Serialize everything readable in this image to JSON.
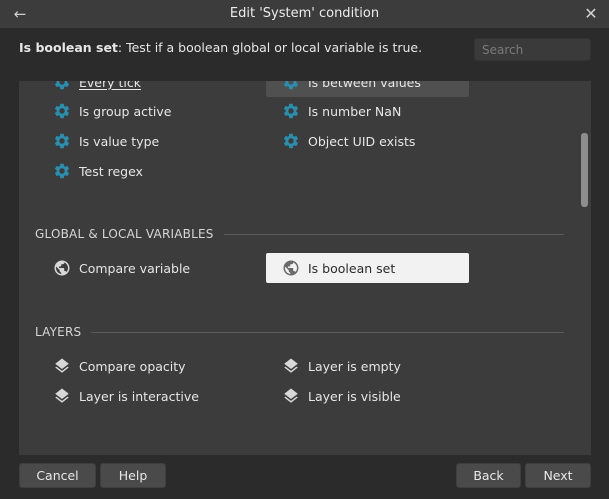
{
  "window": {
    "title": "Edit 'System' condition"
  },
  "description": {
    "name": "Is boolean set",
    "text": ": Test if a boolean global or local variable is true."
  },
  "search": {
    "placeholder": "Search"
  },
  "list": {
    "top_items": [
      {
        "label": "Every tick",
        "icon": "gear-icon"
      },
      {
        "label": "Is between values",
        "icon": "gear-icon"
      },
      {
        "label": "Is group active",
        "icon": "gear-icon"
      },
      {
        "label": "Is number NaN",
        "icon": "gear-icon"
      },
      {
        "label": "Is value type",
        "icon": "gear-icon"
      },
      {
        "label": "Object UID exists",
        "icon": "gear-icon"
      },
      {
        "label": "Test regex",
        "icon": "gear-icon"
      }
    ],
    "sections": [
      {
        "title": "GLOBAL & LOCAL VARIABLES",
        "items": [
          {
            "label": "Compare variable",
            "icon": "globe-icon"
          },
          {
            "label": "Is boolean set",
            "icon": "globe-icon",
            "selected": true
          }
        ]
      },
      {
        "title": "LAYERS",
        "items": [
          {
            "label": "Compare opacity",
            "icon": "layers-icon"
          },
          {
            "label": "Layer is empty",
            "icon": "layers-icon"
          },
          {
            "label": "Layer is interactive",
            "icon": "layers-icon"
          },
          {
            "label": "Layer is visible",
            "icon": "layers-icon"
          }
        ]
      }
    ]
  },
  "buttons": {
    "cancel": "Cancel",
    "help": "Help",
    "back": "Back",
    "next": "Next"
  },
  "colors": {
    "gear": "#2a8fae",
    "globe": "#d8d8d8",
    "layers": "#d8d8d8",
    "selected_bg": "#f2f2f2",
    "highlight_bg": "#505050"
  }
}
